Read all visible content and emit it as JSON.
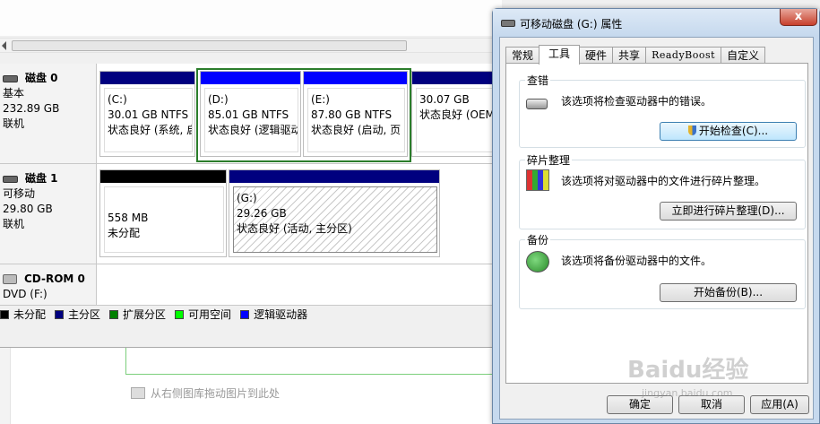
{
  "background": {
    "hint": "从右侧图库拖动图片到此处"
  },
  "disk_manager": {
    "disks": [
      {
        "name": "磁盘 0",
        "type": "基本",
        "size": "232.89 GB",
        "status": "联机",
        "partitions": [
          {
            "label": "(C:)",
            "size": "30.01 GB NTFS",
            "status": "状态良好 (系统, 启",
            "bar_color": "#00007f"
          },
          {
            "label": "(D:)",
            "size": "85.01 GB NTFS",
            "status": "状态良好 (逻辑驱动",
            "bar_color": "#0000ff"
          },
          {
            "label": "(E:)",
            "size": "87.80 GB NTFS",
            "status": "状态良好 (启动, 页",
            "bar_color": "#0000ff"
          },
          {
            "label": "",
            "size": "30.07 GB",
            "status": "状态良好 (OEM",
            "bar_color": "#00007f"
          }
        ]
      },
      {
        "name": "磁盘 1",
        "type": "可移动",
        "size": "29.80 GB",
        "status": "联机",
        "partitions": [
          {
            "label": "",
            "size": "558 MB",
            "status": "未分配",
            "bar_color": "#000000"
          },
          {
            "label": "(G:)",
            "size": "29.26 GB",
            "status": "状态良好 (活动, 主分区)",
            "bar_color": "#00007f"
          }
        ]
      },
      {
        "name": "CD-ROM 0",
        "type": "DVD (F:)"
      }
    ],
    "legend": [
      {
        "label": "未分配",
        "color": "#000000"
      },
      {
        "label": "主分区",
        "color": "#00007f"
      },
      {
        "label": "扩展分区",
        "color": "#008000"
      },
      {
        "label": "可用空间",
        "color": "#00ff00"
      },
      {
        "label": "逻辑驱动器",
        "color": "#0000ff"
      }
    ]
  },
  "dialog": {
    "title": "可移动磁盘 (G:) 属性",
    "close": "x",
    "tabs": [
      "常规",
      "工具",
      "硬件",
      "共享",
      "ReadyBoost",
      "自定义"
    ],
    "active_tab": "工具",
    "groups": [
      {
        "label": "查错",
        "text": "该选项将检查驱动器中的错误。",
        "button": "开始检查(C)...",
        "icon": "drive-icon"
      },
      {
        "label": "碎片整理",
        "text": "该选项将对驱动器中的文件进行碎片整理。",
        "button": "立即进行碎片整理(D)...",
        "icon": "defrag-icon"
      },
      {
        "label": "备份",
        "text": "该选项将备份驱动器中的文件。",
        "button": "开始备份(B)...",
        "icon": "backup-icon"
      }
    ],
    "footer": {
      "ok": "确定",
      "cancel": "取消",
      "apply": "应用(A)"
    }
  },
  "watermark": {
    "text": "Baidu经验",
    "sub": "jingyan.baidu.com"
  }
}
